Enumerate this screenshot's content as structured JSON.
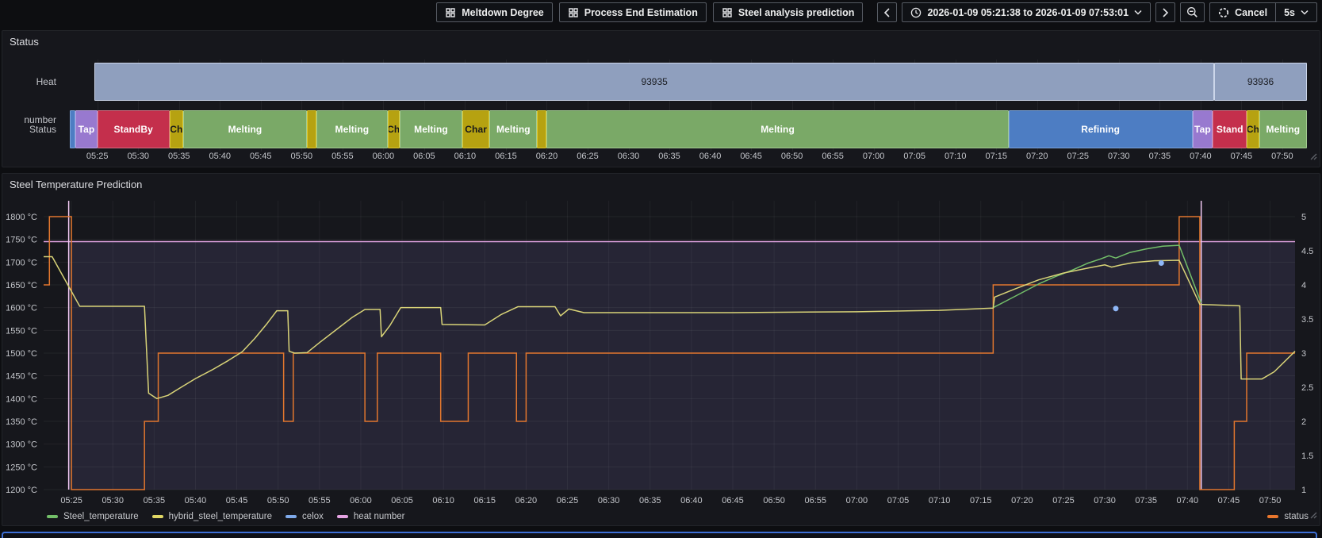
{
  "toolbar": {
    "dashboard_links": [
      "Meltdown Degree",
      "Process End Estimation",
      "Steel analysis prediction"
    ],
    "time_range": "2026-01-09 05:21:38 to 2026-01-09 07:53:01",
    "refresh_cancel_label": "Cancel",
    "refresh_interval": "5s"
  },
  "time_axis": {
    "start": "05:21:38",
    "end": "07:53:01",
    "ticks": [
      "05:25",
      "05:30",
      "05:35",
      "05:40",
      "05:45",
      "05:50",
      "05:55",
      "06:00",
      "06:05",
      "06:10",
      "06:15",
      "06:20",
      "06:25",
      "06:30",
      "06:35",
      "06:40",
      "06:45",
      "06:50",
      "06:55",
      "07:00",
      "07:05",
      "07:10",
      "07:15",
      "07:20",
      "07:25",
      "07:30",
      "07:35",
      "07:40",
      "07:45",
      "07:50"
    ]
  },
  "status_panel": {
    "title": "Status",
    "row_labels": {
      "heat": "Heat number",
      "status": "Status"
    },
    "heat_color": {
      "fill": "#8f9fbe",
      "border": "#ccd6ea",
      "text": "#1a1c21"
    },
    "heat_bars": [
      {
        "label": "93935",
        "from": "05:24:40",
        "to": "07:41:40"
      },
      {
        "label": "93936",
        "from": "07:41:40",
        "to": "07:53:01"
      }
    ],
    "state_colors": {
      "Refining": {
        "fill": "#4d7dc3",
        "border": "#7aa2da",
        "text": "#ffffff"
      },
      "Tap": {
        "fill": "#9879cf",
        "border": "#b9a0e2",
        "text": "#ffffff"
      },
      "StandBy": {
        "fill": "#c42f4c",
        "border": "#d76c81",
        "text": "#ffffff"
      },
      "Charging": {
        "fill": "#b6a211",
        "border": "#dcca33",
        "text": "#17181b"
      },
      "Melting": {
        "fill": "#7aa967",
        "border": "#a3cb91",
        "text": "#ffffff"
      }
    },
    "segments": [
      {
        "state": "Refining",
        "label": "",
        "from": "05:21:38",
        "to": "05:22:20"
      },
      {
        "state": "Tap",
        "label": "Tap",
        "from": "05:22:20",
        "to": "05:25:00"
      },
      {
        "state": "StandBy",
        "label": "StandBy",
        "from": "05:25:00",
        "to": "05:33:50"
      },
      {
        "state": "Charging",
        "label": "Ch",
        "from": "05:33:50",
        "to": "05:35:30"
      },
      {
        "state": "Melting",
        "label": "Melting",
        "from": "05:35:30",
        "to": "05:50:40"
      },
      {
        "state": "Charging",
        "label": "",
        "from": "05:50:40",
        "to": "05:51:50"
      },
      {
        "state": "Melting",
        "label": "Melting",
        "from": "05:51:50",
        "to": "06:00:30"
      },
      {
        "state": "Charging",
        "label": "Ch",
        "from": "06:00:30",
        "to": "06:02:00"
      },
      {
        "state": "Melting",
        "label": "Melting",
        "from": "06:02:00",
        "to": "06:09:40"
      },
      {
        "state": "Charging",
        "label": "Char",
        "from": "06:09:40",
        "to": "06:13:00"
      },
      {
        "state": "Melting",
        "label": "Melting",
        "from": "06:13:00",
        "to": "06:18:50"
      },
      {
        "state": "Charging",
        "label": "",
        "from": "06:18:50",
        "to": "06:20:00"
      },
      {
        "state": "Melting",
        "label": "Melting",
        "from": "06:20:00",
        "to": "07:16:30"
      },
      {
        "state": "Refining",
        "label": "Refining",
        "from": "07:16:30",
        "to": "07:39:00"
      },
      {
        "state": "Tap",
        "label": "Tap",
        "from": "07:39:00",
        "to": "07:41:30"
      },
      {
        "state": "StandBy",
        "label": "Stand",
        "from": "07:41:30",
        "to": "07:45:40"
      },
      {
        "state": "Charging",
        "label": "Ch",
        "from": "07:45:40",
        "to": "07:47:10"
      },
      {
        "state": "Melting",
        "label": "Melting",
        "from": "07:47:10",
        "to": "07:53:01"
      }
    ]
  },
  "chart_panel": {
    "title": "Steel Temperature Prediction",
    "legend": [
      {
        "label": "Steel_temperature",
        "color": "#73bf69"
      },
      {
        "label": "hybrid_steel_temperature",
        "color": "#e0d765"
      },
      {
        "label": "celox",
        "color": "#7ea9ea"
      },
      {
        "label": "heat number",
        "color": "#e5a3e3"
      }
    ],
    "legend_right": {
      "label": "status",
      "color": "#e8762d"
    }
  },
  "chart_data": {
    "type": "line",
    "title": "Steel Temperature Prediction",
    "x_range": [
      "05:21:38",
      "07:53:01"
    ],
    "left_axis": {
      "unit": "°C",
      "min": 1200,
      "max": 1800,
      "ticks": [
        1800,
        1750,
        1700,
        1650,
        1600,
        1550,
        1500,
        1450,
        1400,
        1350,
        1300,
        1250,
        1200
      ]
    },
    "right_axis": {
      "min": 1,
      "max": 5,
      "ticks": [
        5,
        4.5,
        4,
        3.5,
        3,
        2.5,
        2,
        1.5,
        1
      ]
    },
    "grid": true,
    "series": [
      {
        "name": "heat number",
        "type": "heat-band",
        "color": "#e0a2e0",
        "vline_color": "#f2c9f3",
        "fill": "rgba(150,132,222,0.13)",
        "display_level_c": 1745,
        "events": [
          "05:24:40",
          "07:41:40"
        ],
        "values": [
          93935,
          93936
        ]
      },
      {
        "name": "status",
        "type": "step",
        "axis": "right",
        "color": "#e2772e",
        "levels": {
          "StandBy": 1,
          "Charging": 2,
          "Melting": 3,
          "Refining": 4,
          "Tap": 5
        },
        "points": [
          [
            "05:21:38",
            4
          ],
          [
            "05:22:20",
            5
          ],
          [
            "05:25:00",
            1
          ],
          [
            "05:33:50",
            2
          ],
          [
            "05:35:30",
            3
          ],
          [
            "05:50:40",
            2
          ],
          [
            "05:51:50",
            3
          ],
          [
            "06:00:30",
            2
          ],
          [
            "06:02:00",
            3
          ],
          [
            "06:09:40",
            2
          ],
          [
            "06:13:00",
            3
          ],
          [
            "06:18:50",
            2
          ],
          [
            "06:20:00",
            3
          ],
          [
            "07:16:30",
            4
          ],
          [
            "07:39:00",
            5
          ],
          [
            "07:41:30",
            1
          ],
          [
            "07:45:40",
            2
          ],
          [
            "07:47:10",
            3
          ],
          [
            "07:53:01",
            3
          ]
        ]
      },
      {
        "name": "Steel_temperature",
        "type": "line",
        "axis": "left",
        "color": "#73bf69",
        "points": [
          [
            "07:16:30",
            1600
          ],
          [
            "07:18:00",
            1614
          ],
          [
            "07:20:00",
            1633
          ],
          [
            "07:22:00",
            1652
          ],
          [
            "07:24:00",
            1668
          ],
          [
            "07:26:00",
            1682
          ],
          [
            "07:28:00",
            1698
          ],
          [
            "07:29:30",
            1707
          ],
          [
            "07:30:30",
            1714
          ],
          [
            "07:31:20",
            1709
          ],
          [
            "07:33:00",
            1721
          ],
          [
            "07:35:00",
            1729
          ],
          [
            "07:37:00",
            1735
          ],
          [
            "07:39:00",
            1737
          ],
          [
            "07:41:40",
            1610
          ]
        ]
      },
      {
        "name": "hybrid_steel_temperature",
        "type": "line",
        "axis": "left",
        "color": "#d9d478",
        "points": [
          [
            "05:21:38",
            1712
          ],
          [
            "05:22:40",
            1712
          ],
          [
            "05:26:00",
            1603
          ],
          [
            "05:33:50",
            1603
          ],
          [
            "05:34:20",
            1412
          ],
          [
            "05:35:20",
            1400
          ],
          [
            "05:36:40",
            1407
          ],
          [
            "05:38:00",
            1422
          ],
          [
            "05:40:00",
            1444
          ],
          [
            "05:42:00",
            1463
          ],
          [
            "05:44:00",
            1484
          ],
          [
            "05:45:40",
            1503
          ],
          [
            "05:47:10",
            1532
          ],
          [
            "05:48:40",
            1565
          ],
          [
            "05:49:50",
            1593
          ],
          [
            "05:51:10",
            1593
          ],
          [
            "05:51:20",
            1504
          ],
          [
            "05:52:00",
            1500
          ],
          [
            "05:53:30",
            1501
          ],
          [
            "05:55:00",
            1523
          ],
          [
            "05:57:00",
            1551
          ],
          [
            "05:59:00",
            1579
          ],
          [
            "06:00:30",
            1596
          ],
          [
            "06:02:20",
            1596
          ],
          [
            "06:02:30",
            1536
          ],
          [
            "06:03:30",
            1560
          ],
          [
            "06:04:50",
            1600
          ],
          [
            "06:09:40",
            1600
          ],
          [
            "06:09:50",
            1563
          ],
          [
            "06:15:00",
            1562
          ],
          [
            "06:17:00",
            1585
          ],
          [
            "06:19:00",
            1602
          ],
          [
            "06:23:30",
            1602
          ],
          [
            "06:24:10",
            1582
          ],
          [
            "06:25:10",
            1597
          ],
          [
            "06:27:00",
            1589
          ],
          [
            "06:45:00",
            1589
          ],
          [
            "07:00:00",
            1591
          ],
          [
            "07:10:00",
            1594
          ],
          [
            "07:16:30",
            1599
          ],
          [
            "07:16:40",
            1623
          ],
          [
            "07:19:00",
            1640
          ],
          [
            "07:22:00",
            1661
          ],
          [
            "07:25:00",
            1676
          ],
          [
            "07:28:00",
            1687
          ],
          [
            "07:30:00",
            1694
          ],
          [
            "07:30:50",
            1689
          ],
          [
            "07:32:00",
            1694
          ],
          [
            "07:33:30",
            1699
          ],
          [
            "07:36:00",
            1703
          ],
          [
            "07:39:00",
            1704
          ],
          [
            "07:41:30",
            1607
          ],
          [
            "07:46:20",
            1604
          ],
          [
            "07:46:30",
            1443
          ],
          [
            "07:49:00",
            1443
          ],
          [
            "07:50:30",
            1459
          ],
          [
            "07:53:01",
            1504
          ]
        ]
      },
      {
        "name": "celox",
        "type": "points",
        "axis": "left",
        "color": "#8fb7f7",
        "points": [
          [
            "07:31:20",
            1598
          ],
          [
            "07:36:50",
            1698
          ]
        ]
      }
    ]
  }
}
